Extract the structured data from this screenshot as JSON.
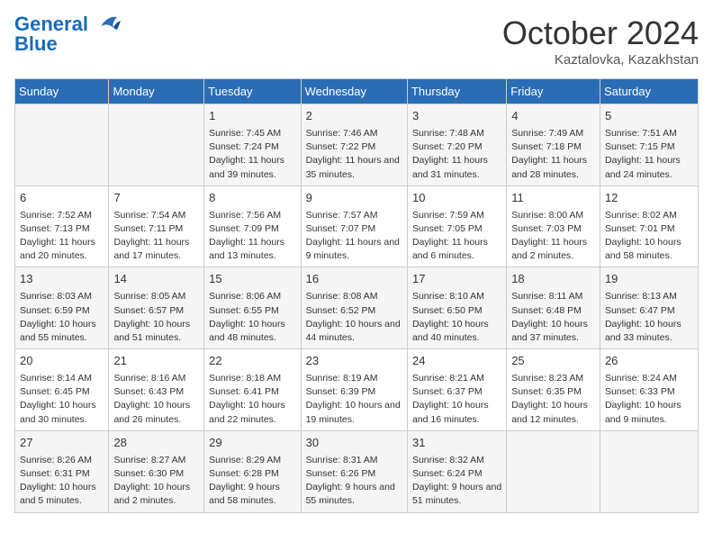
{
  "header": {
    "logo_line1": "General",
    "logo_line2": "Blue",
    "month": "October 2024",
    "location": "Kaztalovka, Kazakhstan"
  },
  "days_of_week": [
    "Sunday",
    "Monday",
    "Tuesday",
    "Wednesday",
    "Thursday",
    "Friday",
    "Saturday"
  ],
  "weeks": [
    [
      {
        "day": "",
        "content": ""
      },
      {
        "day": "",
        "content": ""
      },
      {
        "day": "1",
        "content": "Sunrise: 7:45 AM\nSunset: 7:24 PM\nDaylight: 11 hours and 39 minutes."
      },
      {
        "day": "2",
        "content": "Sunrise: 7:46 AM\nSunset: 7:22 PM\nDaylight: 11 hours and 35 minutes."
      },
      {
        "day": "3",
        "content": "Sunrise: 7:48 AM\nSunset: 7:20 PM\nDaylight: 11 hours and 31 minutes."
      },
      {
        "day": "4",
        "content": "Sunrise: 7:49 AM\nSunset: 7:18 PM\nDaylight: 11 hours and 28 minutes."
      },
      {
        "day": "5",
        "content": "Sunrise: 7:51 AM\nSunset: 7:15 PM\nDaylight: 11 hours and 24 minutes."
      }
    ],
    [
      {
        "day": "6",
        "content": "Sunrise: 7:52 AM\nSunset: 7:13 PM\nDaylight: 11 hours and 20 minutes."
      },
      {
        "day": "7",
        "content": "Sunrise: 7:54 AM\nSunset: 7:11 PM\nDaylight: 11 hours and 17 minutes."
      },
      {
        "day": "8",
        "content": "Sunrise: 7:56 AM\nSunset: 7:09 PM\nDaylight: 11 hours and 13 minutes."
      },
      {
        "day": "9",
        "content": "Sunrise: 7:57 AM\nSunset: 7:07 PM\nDaylight: 11 hours and 9 minutes."
      },
      {
        "day": "10",
        "content": "Sunrise: 7:59 AM\nSunset: 7:05 PM\nDaylight: 11 hours and 6 minutes."
      },
      {
        "day": "11",
        "content": "Sunrise: 8:00 AM\nSunset: 7:03 PM\nDaylight: 11 hours and 2 minutes."
      },
      {
        "day": "12",
        "content": "Sunrise: 8:02 AM\nSunset: 7:01 PM\nDaylight: 10 hours and 58 minutes."
      }
    ],
    [
      {
        "day": "13",
        "content": "Sunrise: 8:03 AM\nSunset: 6:59 PM\nDaylight: 10 hours and 55 minutes."
      },
      {
        "day": "14",
        "content": "Sunrise: 8:05 AM\nSunset: 6:57 PM\nDaylight: 10 hours and 51 minutes."
      },
      {
        "day": "15",
        "content": "Sunrise: 8:06 AM\nSunset: 6:55 PM\nDaylight: 10 hours and 48 minutes."
      },
      {
        "day": "16",
        "content": "Sunrise: 8:08 AM\nSunset: 6:52 PM\nDaylight: 10 hours and 44 minutes."
      },
      {
        "day": "17",
        "content": "Sunrise: 8:10 AM\nSunset: 6:50 PM\nDaylight: 10 hours and 40 minutes."
      },
      {
        "day": "18",
        "content": "Sunrise: 8:11 AM\nSunset: 6:48 PM\nDaylight: 10 hours and 37 minutes."
      },
      {
        "day": "19",
        "content": "Sunrise: 8:13 AM\nSunset: 6:47 PM\nDaylight: 10 hours and 33 minutes."
      }
    ],
    [
      {
        "day": "20",
        "content": "Sunrise: 8:14 AM\nSunset: 6:45 PM\nDaylight: 10 hours and 30 minutes."
      },
      {
        "day": "21",
        "content": "Sunrise: 8:16 AM\nSunset: 6:43 PM\nDaylight: 10 hours and 26 minutes."
      },
      {
        "day": "22",
        "content": "Sunrise: 8:18 AM\nSunset: 6:41 PM\nDaylight: 10 hours and 22 minutes."
      },
      {
        "day": "23",
        "content": "Sunrise: 8:19 AM\nSunset: 6:39 PM\nDaylight: 10 hours and 19 minutes."
      },
      {
        "day": "24",
        "content": "Sunrise: 8:21 AM\nSunset: 6:37 PM\nDaylight: 10 hours and 16 minutes."
      },
      {
        "day": "25",
        "content": "Sunrise: 8:23 AM\nSunset: 6:35 PM\nDaylight: 10 hours and 12 minutes."
      },
      {
        "day": "26",
        "content": "Sunrise: 8:24 AM\nSunset: 6:33 PM\nDaylight: 10 hours and 9 minutes."
      }
    ],
    [
      {
        "day": "27",
        "content": "Sunrise: 8:26 AM\nSunset: 6:31 PM\nDaylight: 10 hours and 5 minutes."
      },
      {
        "day": "28",
        "content": "Sunrise: 8:27 AM\nSunset: 6:30 PM\nDaylight: 10 hours and 2 minutes."
      },
      {
        "day": "29",
        "content": "Sunrise: 8:29 AM\nSunset: 6:28 PM\nDaylight: 9 hours and 58 minutes."
      },
      {
        "day": "30",
        "content": "Sunrise: 8:31 AM\nSunset: 6:26 PM\nDaylight: 9 hours and 55 minutes."
      },
      {
        "day": "31",
        "content": "Sunrise: 8:32 AM\nSunset: 6:24 PM\nDaylight: 9 hours and 51 minutes."
      },
      {
        "day": "",
        "content": ""
      },
      {
        "day": "",
        "content": ""
      }
    ]
  ]
}
